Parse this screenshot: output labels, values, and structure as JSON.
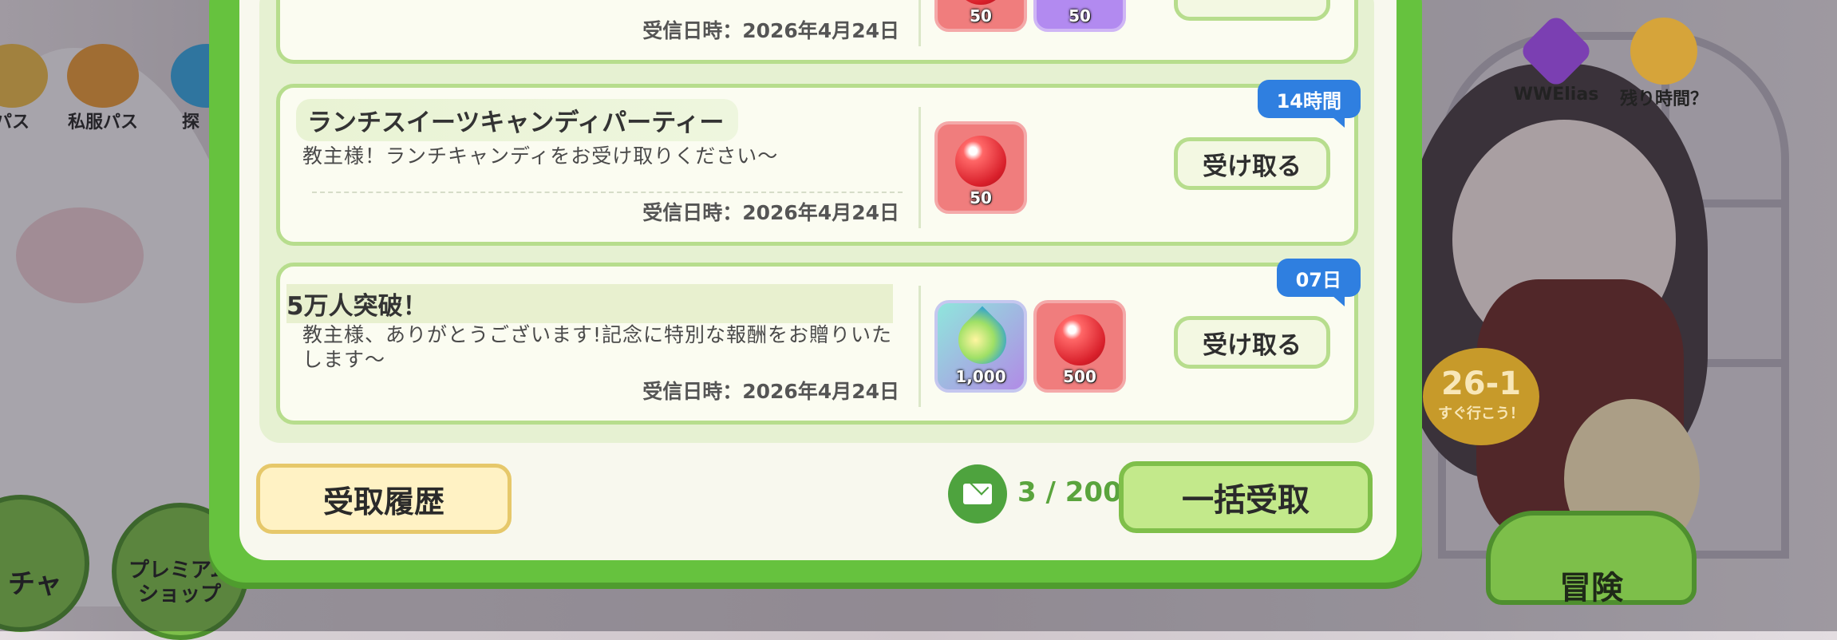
{
  "left_icons": [
    {
      "label": "パス"
    },
    {
      "label": "私服パス"
    },
    {
      "label": "探"
    },
    {
      "label": "チャ"
    },
    {
      "label": "プレミアムショップ"
    }
  ],
  "top_right_icons": [
    {
      "label": "WWElias"
    },
    {
      "label": "残り時間？"
    }
  ],
  "messages": [
    {
      "title": "",
      "body": "",
      "date": "受信日時：2026年4月24日",
      "rewards": [
        {
          "type": "red-orb",
          "qty": "50"
        },
        {
          "type": "purple-item",
          "qty": "50"
        }
      ]
    },
    {
      "title": "ランチスイーツキャンディパーティー",
      "body": "教主様！ランチキャンディをお受け取りください〜",
      "date": "受信日時：2026年4月24日",
      "timer": "14時間",
      "claim": "受け取る",
      "rewards": [
        {
          "type": "red-orb",
          "qty": "50"
        }
      ]
    },
    {
      "title": "5万人突破！",
      "body": "教主様、ありがとうございます!記念に特別な報酬をお贈りいたします〜",
      "date": "受信日時：2026年4月24日",
      "timer": "07日",
      "claim": "受け取る",
      "rewards": [
        {
          "type": "rainbow-leaf",
          "qty": "1,000"
        },
        {
          "type": "red-orb",
          "qty": "500"
        }
      ]
    }
  ],
  "footer": {
    "history_label": "受取履歴",
    "mail_count": "3 / 200",
    "claim_all_label": "一括受取"
  },
  "stage": {
    "number": "26-1",
    "sub": "すぐ行こう！"
  },
  "adventure_label": "冒険"
}
